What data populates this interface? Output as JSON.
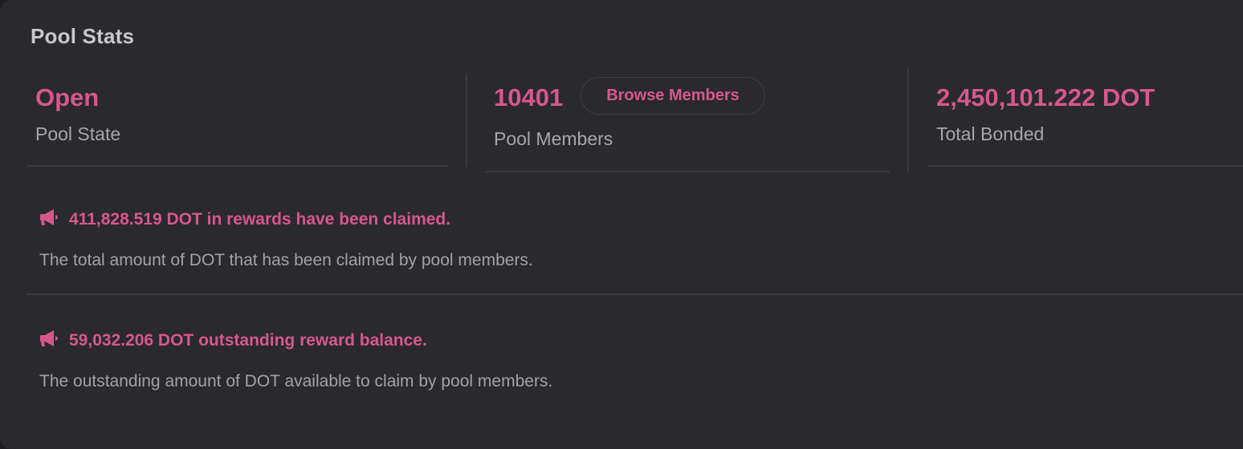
{
  "card": {
    "title": "Pool Stats"
  },
  "stats": [
    {
      "value": "Open",
      "label": "Pool State"
    },
    {
      "value": "10401",
      "label": "Pool Members",
      "action_label": "Browse Members"
    },
    {
      "value": "2,450,101.222 DOT",
      "label": "Total Bonded"
    }
  ],
  "notices": [
    {
      "icon": "megaphone-icon",
      "heading": "411,828.519 DOT in rewards have been claimed.",
      "description": "The total amount of DOT that has been claimed by pool members."
    },
    {
      "icon": "megaphone-icon",
      "heading": "59,032.206 DOT outstanding reward balance.",
      "description": "The outstanding amount of DOT available to claim by pool members."
    }
  ],
  "colors": {
    "accent": "#d6588a",
    "card_background": "#2a292e",
    "text_primary": "#c9c7cd",
    "text_secondary": "#a8a6ab",
    "divider": "#3a383e"
  }
}
